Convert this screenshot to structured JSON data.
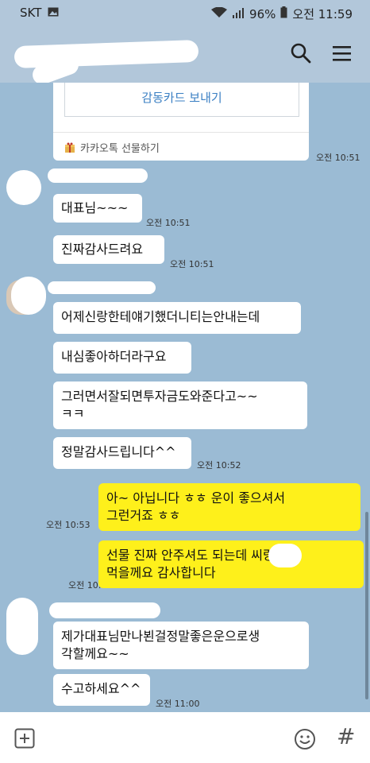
{
  "status": {
    "carrier": "SKT",
    "battery": "96%",
    "time": "오전 11:59"
  },
  "header": {
    "icons": [
      "search-icon",
      "menu-icon"
    ]
  },
  "card": {
    "button_label": "감동카드 보내기",
    "footer_label": "카카오톡 선물하기",
    "time": "오전 10:51"
  },
  "messages": [
    {
      "side": "other",
      "text": "대표님~~~",
      "time": "오전 10:51"
    },
    {
      "side": "other",
      "text": "진짜감사드려요",
      "time": "오전 10:51"
    },
    {
      "side": "other",
      "text": "어제신랑한테얘기했더니티는안내는데",
      "time": ""
    },
    {
      "side": "other",
      "text": "내심좋아하더라구요",
      "time": ""
    },
    {
      "side": "other",
      "text": "그러면서잘되면투자금도와준다고~~\nㅋㅋ",
      "time": ""
    },
    {
      "side": "other",
      "text": "정말감사드립니다^^",
      "time": "오전 10:52"
    },
    {
      "side": "me",
      "text": "아~ 아닙니다 ㅎㅎ 운이 좋으셔서\n그런거죠 ㅎㅎ",
      "time": "오전 10:53"
    },
    {
      "side": "me",
      "text": "선물 진짜 안주셔도 되는데      씨랑 잘\n먹을께요 감사합니다",
      "time": "오전 10:54"
    },
    {
      "side": "other",
      "text": "제가대표님만나뵌걸정말좋은운으로생\n각할께요~~",
      "time": ""
    },
    {
      "side": "other",
      "text": "수고하세요^^",
      "time": "오전 11:00"
    }
  ],
  "input": {
    "icons": [
      "plus-icon",
      "emoji-icon",
      "hashtag-icon"
    ],
    "hashtag_symbol": "#"
  },
  "colors": {
    "chat_bg": "#9bbbd4",
    "my_bubble": "#fef01b",
    "other_bubble": "#ffffff",
    "link_blue": "#3a7fc3"
  }
}
